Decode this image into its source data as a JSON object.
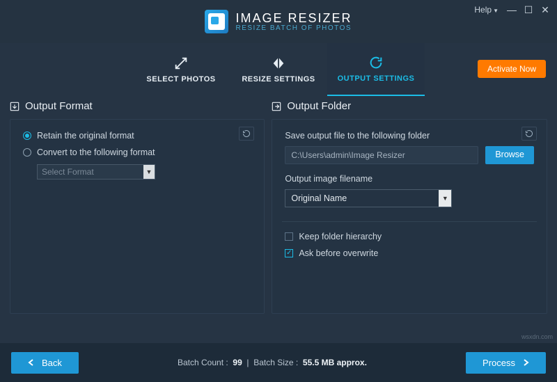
{
  "brand": {
    "title": "IMAGE RESIZER",
    "subtitle": "RESIZE BATCH OF PHOTOS"
  },
  "window": {
    "help": "Help"
  },
  "tabs": {
    "select": "SELECT PHOTOS",
    "resize": "RESIZE SETTINGS",
    "output": "OUTPUT SETTINGS",
    "activate": "Activate Now"
  },
  "format": {
    "title": "Output Format",
    "retain": "Retain the original format",
    "convert": "Convert to the following format",
    "selectPlaceholder": "Select Format"
  },
  "folder": {
    "title": "Output Folder",
    "saveLabel": "Save output file to the following folder",
    "path": "C:\\Users\\admin\\Image Resizer",
    "browse": "Browse",
    "filenameLabel": "Output image filename",
    "filenameValue": "Original Name",
    "keepHierarchy": "Keep folder hierarchy",
    "askOverwrite": "Ask before overwrite"
  },
  "footer": {
    "back": "Back",
    "countLabel": "Batch Count :",
    "countValue": "99",
    "sizeLabel": "Batch Size :",
    "sizeValue": "55.5 MB approx.",
    "process": "Process"
  },
  "watermark": "wsxdn.com"
}
